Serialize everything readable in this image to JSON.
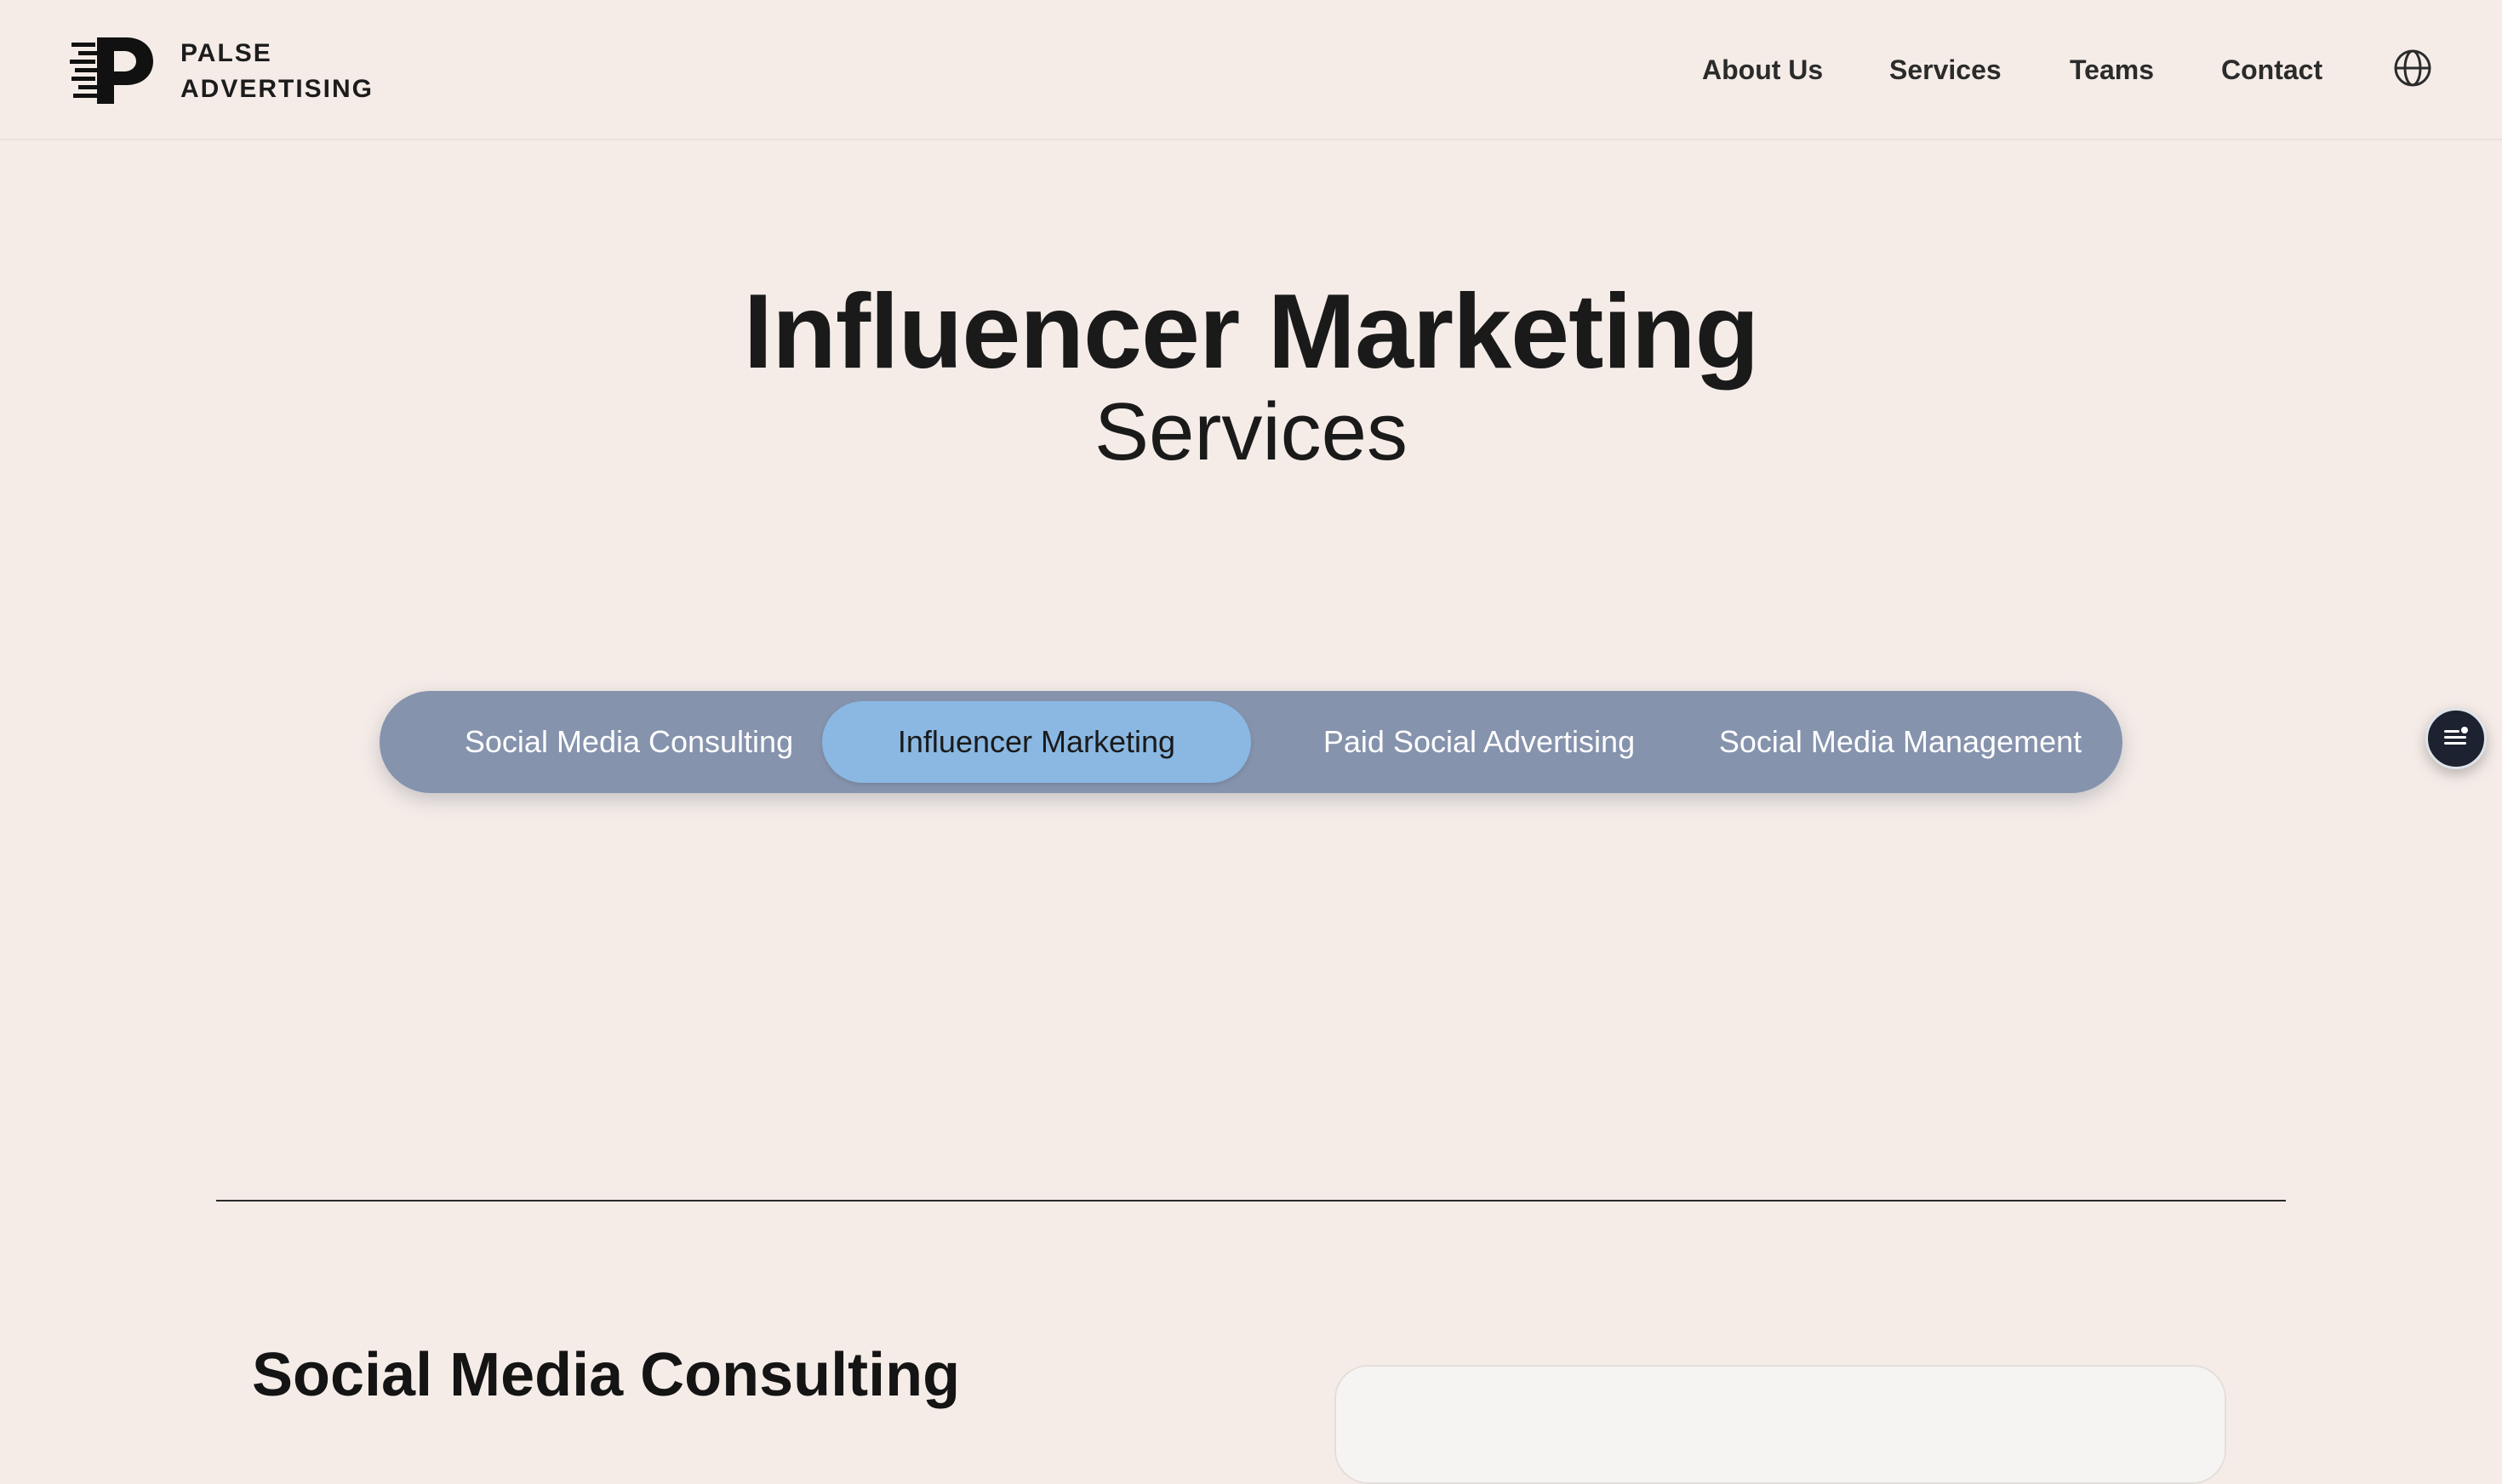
{
  "brand": {
    "line1": "PALSE",
    "line2": "ADVERTISING",
    "logo_icon": "p-speed-logo-icon"
  },
  "nav": {
    "items": [
      {
        "label": "About Us"
      },
      {
        "label": "Services"
      },
      {
        "label": "Teams"
      },
      {
        "label": "Contact"
      }
    ],
    "language_icon": "globe-icon"
  },
  "hero": {
    "title": "Influencer Marketing",
    "subtitle": "Services"
  },
  "service_tabs": {
    "items": [
      {
        "label": "Social Media Consulting",
        "active": false
      },
      {
        "label": "Influencer Marketing",
        "active": true
      },
      {
        "label": "Paid Social Advertising",
        "active": false
      },
      {
        "label": "Social Media Management",
        "active": false
      }
    ]
  },
  "fab": {
    "icon": "menu-list-icon"
  },
  "section": {
    "title": "Social Media Consulting"
  },
  "colors": {
    "background": "#f5ece8",
    "tab_bar": "#8693ad",
    "tab_active": "#8ab8e2",
    "text_dark": "#1a1a1a",
    "fab": "#1d2230"
  }
}
